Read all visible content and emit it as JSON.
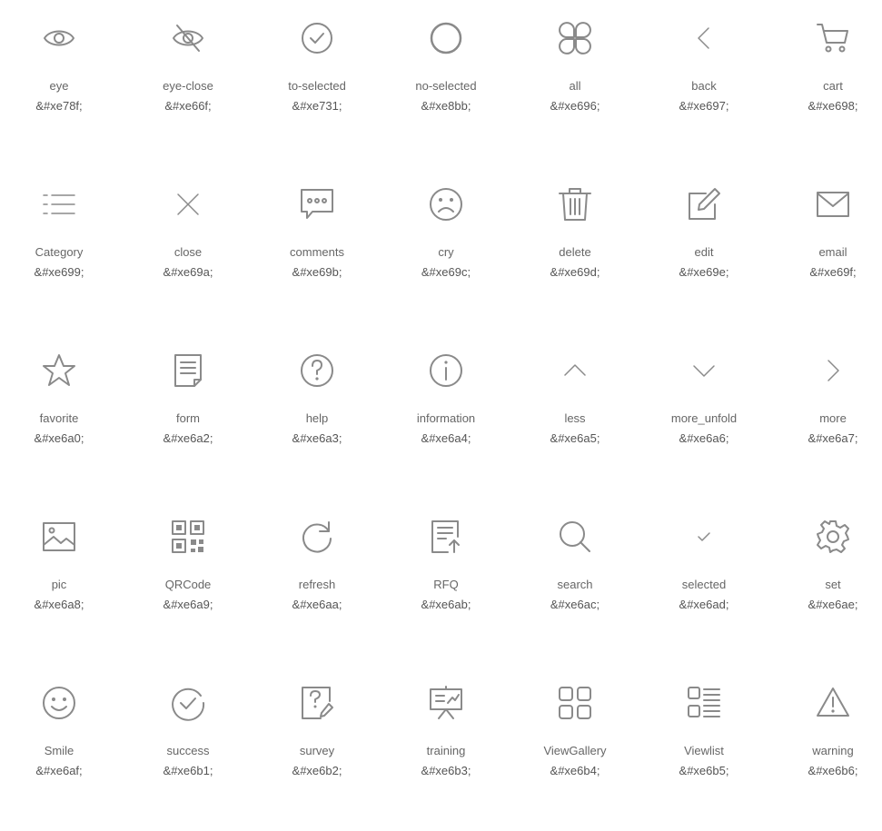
{
  "icons": [
    {
      "name": "eye",
      "code": "&#xe78f;"
    },
    {
      "name": "eye-close",
      "code": "&#xe66f;"
    },
    {
      "name": "to-selected",
      "code": "&#xe731;"
    },
    {
      "name": "no-selected",
      "code": "&#xe8bb;"
    },
    {
      "name": "all",
      "code": "&#xe696;"
    },
    {
      "name": "back",
      "code": "&#xe697;"
    },
    {
      "name": "cart",
      "code": "&#xe698;"
    },
    {
      "name": "Category",
      "code": "&#xe699;"
    },
    {
      "name": "close",
      "code": "&#xe69a;"
    },
    {
      "name": "comments",
      "code": "&#xe69b;"
    },
    {
      "name": "cry",
      "code": "&#xe69c;"
    },
    {
      "name": "delete",
      "code": "&#xe69d;"
    },
    {
      "name": "edit",
      "code": "&#xe69e;"
    },
    {
      "name": "email",
      "code": "&#xe69f;"
    },
    {
      "name": "favorite",
      "code": "&#xe6a0;"
    },
    {
      "name": "form",
      "code": "&#xe6a2;"
    },
    {
      "name": "help",
      "code": "&#xe6a3;"
    },
    {
      "name": "information",
      "code": "&#xe6a4;"
    },
    {
      "name": "less",
      "code": "&#xe6a5;"
    },
    {
      "name": "more_unfold",
      "code": "&#xe6a6;"
    },
    {
      "name": "more",
      "code": "&#xe6a7;"
    },
    {
      "name": "pic",
      "code": "&#xe6a8;"
    },
    {
      "name": "QRCode",
      "code": "&#xe6a9;"
    },
    {
      "name": "refresh",
      "code": "&#xe6aa;"
    },
    {
      "name": "RFQ",
      "code": "&#xe6ab;"
    },
    {
      "name": "search",
      "code": "&#xe6ac;"
    },
    {
      "name": "selected",
      "code": "&#xe6ad;"
    },
    {
      "name": "set",
      "code": "&#xe6ae;"
    },
    {
      "name": "Smile",
      "code": "&#xe6af;"
    },
    {
      "name": "success",
      "code": "&#xe6b1;"
    },
    {
      "name": "survey",
      "code": "&#xe6b2;"
    },
    {
      "name": "training",
      "code": "&#xe6b3;"
    },
    {
      "name": "ViewGallery",
      "code": "&#xe6b4;"
    },
    {
      "name": "Viewlist",
      "code": "&#xe6b5;"
    },
    {
      "name": "warning",
      "code": "&#xe6b6;"
    }
  ],
  "colors": {
    "icon": "#8a8a8a",
    "label": "#666666",
    "background": "#ffffff"
  }
}
